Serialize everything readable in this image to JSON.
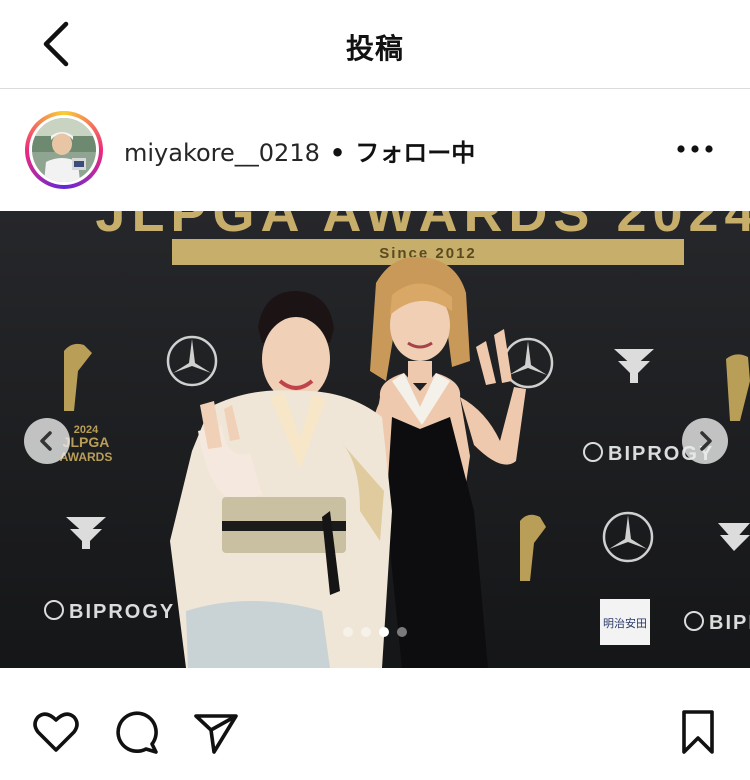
{
  "header": {
    "title": "投稿",
    "back_icon": "chevron-left-icon"
  },
  "post": {
    "username": "miyakore__0218",
    "separator": "•",
    "follow_status": "フォロー中",
    "more_icon": "more-horizontal-icon",
    "avatar_ring_colors": [
      "#f9ce34",
      "#ee2a7b",
      "#6228d7"
    ]
  },
  "media": {
    "backdrop": {
      "title_text": "JLPGA AWARDS 2024",
      "since_text": "Since 2012",
      "award_logo_text": [
        "2024",
        "JLPGA",
        "AWARDS"
      ],
      "sponsor_biprogy": "BIPROGY",
      "sponsor_meiji": "明治安田"
    },
    "carousel": {
      "dot_count": 4,
      "active_index": 2,
      "prev_icon": "chevron-left-circle-icon",
      "next_icon": "chevron-right-circle-icon"
    }
  },
  "actions": {
    "like_icon": "heart-icon",
    "comment_icon": "comment-icon",
    "share_icon": "send-icon",
    "save_icon": "bookmark-icon"
  },
  "colors": {
    "backdrop": "#1b1c1e",
    "gold": "#c7ae6a",
    "divider": "#dbdbdb"
  }
}
